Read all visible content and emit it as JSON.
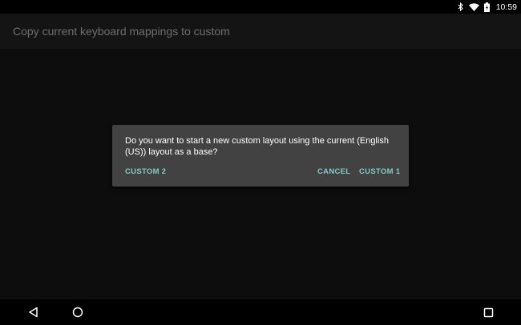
{
  "status_bar": {
    "time": "10:59",
    "icons": [
      "bluetooth-icon",
      "wifi-icon",
      "battery-icon"
    ]
  },
  "app_bar": {
    "title": "Copy current keyboard mappings to custom"
  },
  "dialog": {
    "message": "Do you want to start a new custom layout using the current (English (US)) layout as a base?",
    "buttons": {
      "custom2": "CUSTOM 2",
      "cancel": "CANCEL",
      "custom1": "CUSTOM 1"
    },
    "accent_color": "#80cbc4"
  },
  "nav_bar": {
    "icons": [
      "back-icon",
      "home-icon",
      "recents-icon"
    ]
  }
}
